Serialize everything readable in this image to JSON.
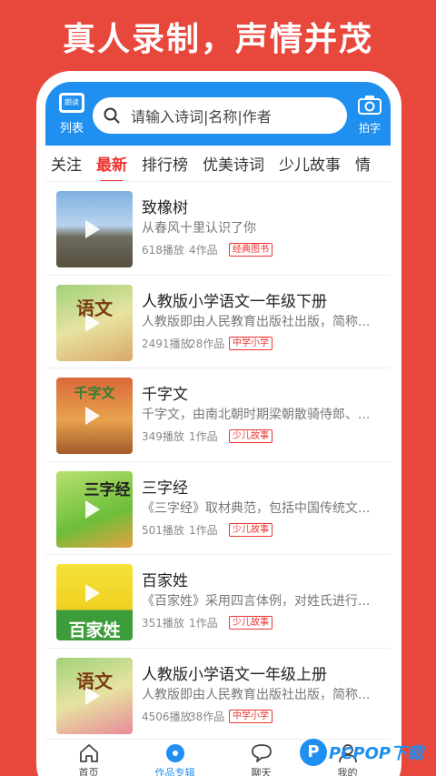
{
  "promo": {
    "title": "真人录制，声情并茂"
  },
  "header": {
    "list_label": "列表",
    "list_icon_text": "朗读",
    "search_placeholder": "请输入诗词|名称|作者",
    "photo_label": "拍字"
  },
  "tabs": [
    {
      "label": "关注",
      "active": false
    },
    {
      "label": "最新",
      "active": true
    },
    {
      "label": "排行榜",
      "active": false
    },
    {
      "label": "优美诗词",
      "active": false
    },
    {
      "label": "少儿故事",
      "active": false
    },
    {
      "label": "情",
      "active": false
    }
  ],
  "items": [
    {
      "title": "致橡树",
      "desc": "从春风十里认识了你",
      "plays": "618播放",
      "works": "4作品",
      "badge": "经典图书",
      "thumb_text": ""
    },
    {
      "title": "人教版小学语文一年级下册",
      "desc": "人教版即由人民教育出版社出版，简称...",
      "plays": "2491播放",
      "works": "28作品",
      "badge": "中学小学",
      "thumb_text": "语文"
    },
    {
      "title": "千字文",
      "desc": "千字文，由南北朝时期梁朝散骑侍郎、...",
      "plays": "349播放",
      "works": "1作品",
      "badge": "少儿故事",
      "thumb_text": "千字文"
    },
    {
      "title": "三字经",
      "desc": "《三字经》取材典范，包括中国传统文...",
      "plays": "501播放",
      "works": "1作品",
      "badge": "少儿故事",
      "thumb_text": "三字经"
    },
    {
      "title": "百家姓",
      "desc": "《百家姓》采用四言体例，对姓氏进行...",
      "plays": "351播放",
      "works": "1作品",
      "badge": "少儿故事",
      "thumb_text": "百家姓"
    },
    {
      "title": "人教版小学语文一年级上册",
      "desc": "人教版即由人民教育出版社出版，简称...",
      "plays": "4506播放",
      "works": "38作品",
      "badge": "中学小学",
      "thumb_text": "语文"
    }
  ],
  "bottom_nav": [
    {
      "label": "首页",
      "icon": "home-icon"
    },
    {
      "label": "作品专辑",
      "icon": "disc-icon"
    },
    {
      "label": "聊天",
      "icon": "chat-icon"
    },
    {
      "label": "我的",
      "icon": "user-icon"
    }
  ],
  "watermark": {
    "letter": "P",
    "text": "PCPOP下载"
  },
  "colors": {
    "brand_red": "#e8483c",
    "header_blue": "#1f8ff0",
    "active_tab": "#e33"
  }
}
